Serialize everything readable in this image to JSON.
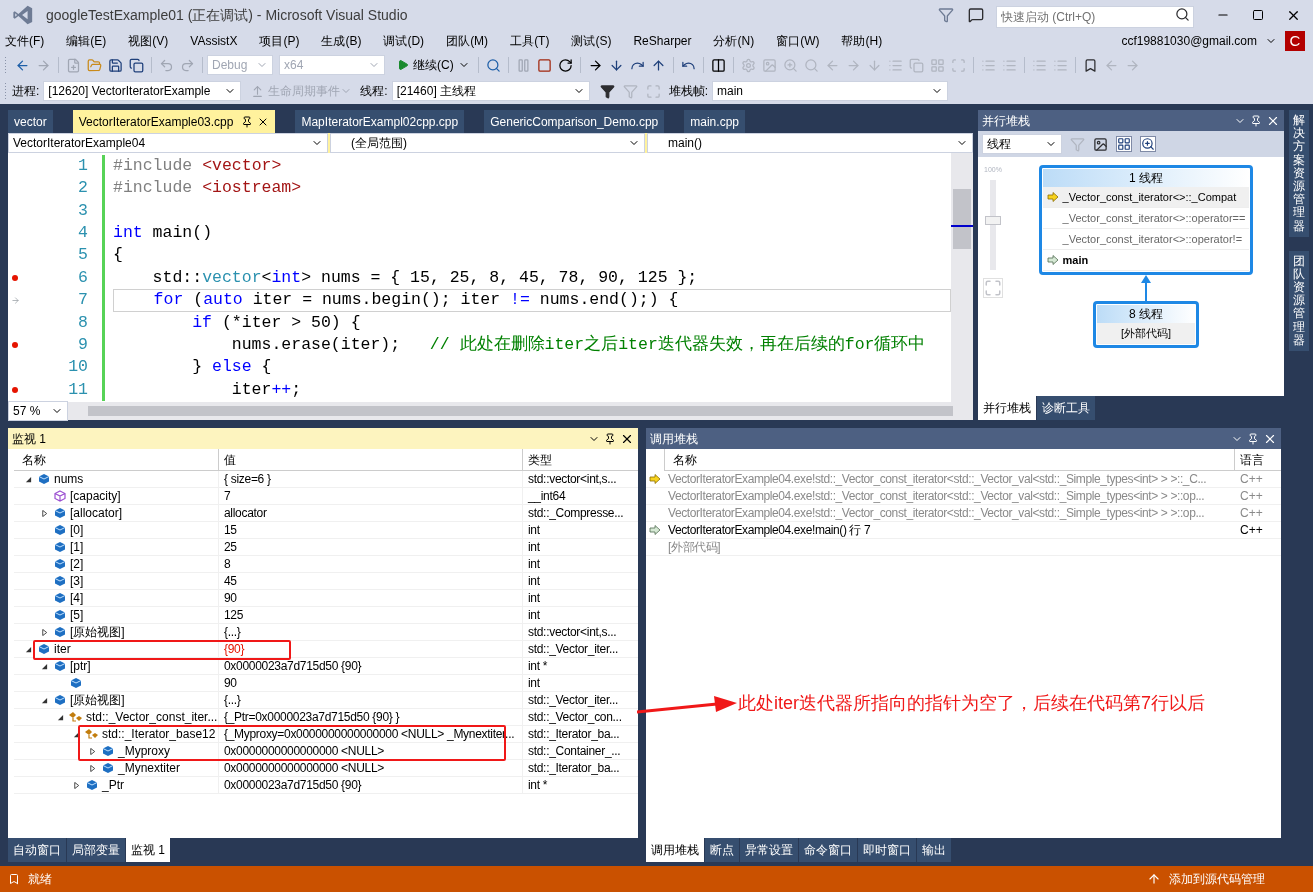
{
  "window": {
    "title": "googleTestExample01 (正在调试) - Microsoft Visual Studio",
    "quick_launch": {
      "placeholder": "快速启动 (Ctrl+Q)"
    },
    "account": "ccf19881030@gmail.com",
    "avatar_letter": "C"
  },
  "menu": [
    "文件(F)",
    "编辑(E)",
    "视图(V)",
    "VAssistX",
    "项目(P)",
    "生成(B)",
    "调试(D)",
    "团队(M)",
    "工具(T)",
    "测试(S)",
    "ReSharper",
    "分析(N)",
    "窗口(W)",
    "帮助(H)"
  ],
  "toolbar": {
    "configuration": "Debug",
    "platform": "x64",
    "continue": "继续(C)",
    "process_label": "进程:",
    "process": "[12620] VectorIteratorExample",
    "lifecycle": "生命周期事件",
    "thread_label": "线程:",
    "thread": "[21460] 主线程",
    "stack_frame_label": "堆栈帧:",
    "stack_frame": "main"
  },
  "document_tabs": [
    {
      "label": "vector",
      "selected": false
    },
    {
      "label": "VectorIteratorExample03.cpp",
      "selected": true
    },
    {
      "label": "MapIteratorExampl02cpp.cpp",
      "selected": false
    },
    {
      "label": "GenericComparison_Demo.cpp",
      "selected": false
    },
    {
      "label": "main.cpp",
      "selected": false
    }
  ],
  "navigation": {
    "project": "VectorIteratorExample04",
    "scope": "(全局范围)",
    "member": "main()"
  },
  "editor": {
    "zoom": "57 %",
    "lines": [
      {
        "number": "1",
        "breakpoint": false,
        "current": false,
        "tokens": [
          {
            "kind": "preprocessor",
            "text": "#include "
          },
          {
            "kind": "string",
            "text": "<vector>"
          }
        ]
      },
      {
        "number": "2",
        "breakpoint": false,
        "current": false,
        "tokens": [
          {
            "kind": "preprocessor",
            "text": "#include "
          },
          {
            "kind": "string",
            "text": "<iostream>"
          }
        ]
      },
      {
        "number": "3",
        "breakpoint": false,
        "current": false
      },
      {
        "number": "4",
        "breakpoint": false,
        "current": false,
        "tokens": [
          {
            "kind": "keyword",
            "text": "int"
          },
          {
            "kind": "plain",
            "text": " main()"
          }
        ]
      },
      {
        "number": "5",
        "breakpoint": false,
        "current": false,
        "tokens": [
          {
            "kind": "plain",
            "text": "{"
          }
        ]
      },
      {
        "number": "6",
        "breakpoint": true,
        "current": false,
        "tokens": [
          {
            "kind": "plain",
            "text": "    std::"
          },
          {
            "kind": "type",
            "text": "vector"
          },
          {
            "kind": "plain",
            "text": "<"
          },
          {
            "kind": "keyword",
            "text": "int"
          },
          {
            "kind": "plain",
            "text": "> nums = { 15, 25, 8, 45, 78, 90, 125 };"
          }
        ]
      },
      {
        "number": "7",
        "breakpoint": false,
        "current": true,
        "tokens": [
          {
            "kind": "keyword",
            "text": "    for"
          },
          {
            "kind": "plain",
            "text": " ("
          },
          {
            "kind": "keyword",
            "text": "auto"
          },
          {
            "kind": "plain",
            "text": " iter = nums.begin(); iter "
          },
          {
            "kind": "keyword",
            "text": "!="
          },
          {
            "kind": "plain",
            "text": " nums.end();) {"
          }
        ]
      },
      {
        "number": "8",
        "breakpoint": false,
        "current": false,
        "tokens": [
          {
            "kind": "keyword",
            "text": "        if"
          },
          {
            "kind": "plain",
            "text": " (*iter > 50) {"
          }
        ]
      },
      {
        "number": "9",
        "breakpoint": true,
        "current": false,
        "tokens": [
          {
            "kind": "plain",
            "text": "            nums.erase(iter);   "
          },
          {
            "kind": "comment",
            "text": "// 此处在删除iter之后iter迭代器失效，再在后续的for循环中"
          }
        ]
      },
      {
        "number": "10",
        "breakpoint": false,
        "current": false,
        "tokens": [
          {
            "kind": "plain",
            "text": "        } "
          },
          {
            "kind": "keyword",
            "text": "else"
          },
          {
            "kind": "plain",
            "text": " {"
          }
        ]
      },
      {
        "number": "11",
        "breakpoint": true,
        "current": false,
        "tokens": [
          {
            "kind": "plain",
            "text": "            iter"
          },
          {
            "kind": "keyword",
            "text": "++"
          },
          {
            "kind": "plain",
            "text": ";"
          }
        ]
      }
    ]
  },
  "parallel_stacks": {
    "title": "并行堆栈",
    "view": "线程",
    "zoom_label": "100%",
    "zoom": {
      "level": 0.55
    },
    "groups": [
      {
        "header": "1 线程",
        "frames": [
          {
            "text": "_Vector_const_iterator<>::_Compat",
            "kind": "current",
            "bold": false
          },
          {
            "text": "_Vector_const_iterator<>::operator==",
            "kind": "frame",
            "bold": false
          },
          {
            "text": "_Vector_const_iterator<>::operator!=",
            "kind": "frame",
            "bold": false
          },
          {
            "text": "main",
            "kind": "caller",
            "bold": true
          }
        ]
      },
      {
        "header": "8 线程",
        "frames": [
          {
            "text": "[外部代码]",
            "kind": "external",
            "bold": false
          }
        ]
      }
    ],
    "tabs": [
      {
        "label": "并行堆栈",
        "selected": true
      },
      {
        "label": "诊断工具",
        "selected": false
      }
    ]
  },
  "side_tabs": [
    "解决方案资源管理器",
    "团队资源管理器"
  ],
  "watch": {
    "title": "监视 1",
    "columns": [
      "名称",
      "值",
      "类型"
    ],
    "rows": [
      {
        "name": "nums",
        "value": "{ size=6 }",
        "type": "std::vector<int,s...",
        "kind": "field",
        "expanded": true,
        "changed": false,
        "children": [
          {
            "name": "[capacity]",
            "value": "7",
            "type": "__int64",
            "kind": "property",
            "changed": false
          },
          {
            "name": "[allocator]",
            "value": "allocator",
            "type": "std::_Compresse...",
            "kind": "field",
            "expanded": false,
            "changed": false
          },
          {
            "name": "[0]",
            "value": "15",
            "type": "int",
            "kind": "field",
            "changed": false
          },
          {
            "name": "[1]",
            "value": "25",
            "type": "int",
            "kind": "field",
            "changed": false
          },
          {
            "name": "[2]",
            "value": "8",
            "type": "int",
            "kind": "field",
            "changed": false
          },
          {
            "name": "[3]",
            "value": "45",
            "type": "int",
            "kind": "field",
            "changed": false
          },
          {
            "name": "[4]",
            "value": "90",
            "type": "int",
            "kind": "field",
            "changed": false
          },
          {
            "name": "[5]",
            "value": "125",
            "type": "int",
            "kind": "field",
            "changed": false
          },
          {
            "name": "[原始视图]",
            "value": "{...}",
            "type": "std::vector<int,s...",
            "kind": "field",
            "expanded": false,
            "changed": false
          }
        ]
      },
      {
        "name": "iter",
        "value": "{90}",
        "type": "std::_Vector_iter...",
        "kind": "field",
        "expanded": true,
        "changed": true,
        "children": [
          {
            "name": "[ptr]",
            "value": "0x0000023a7d715d50 {90}",
            "type": "int *",
            "kind": "field",
            "expanded": true,
            "changed": false,
            "children": [
              {
                "value": "90",
                "type": "int",
                "kind": "field",
                "changed": false
              }
            ]
          },
          {
            "name": "[原始视图]",
            "value": "{...}",
            "type": "std::_Vector_iter...",
            "kind": "field",
            "expanded": true,
            "changed": false,
            "children": [
              {
                "name": "std::_Vector_const_iter...",
                "value": "{_Ptr=0x0000023a7d715d50 {90} }",
                "type": "std::_Vector_con...",
                "kind": "base",
                "expanded": true,
                "changed": false,
                "children": [
                  {
                    "name": "std::_Iterator_base12",
                    "value": "{_Myproxy=0x0000000000000000 <NULL> _Mynextiter...",
                    "type": "std::_Iterator_ba...",
                    "kind": "base",
                    "expanded": true,
                    "changed": false,
                    "children": [
                      {
                        "name": "_Myproxy",
                        "value": "0x0000000000000000 <NULL>",
                        "type": "std::_Container_...",
                        "kind": "field",
                        "expanded": false,
                        "changed": false
                      },
                      {
                        "name": "_Mynextiter",
                        "value": "0x0000000000000000 <NULL>",
                        "type": "std::_Iterator_ba...",
                        "kind": "field",
                        "expanded": false,
                        "changed": false
                      }
                    ]
                  },
                  {
                    "name": "_Ptr",
                    "value": "0x0000023a7d715d50 {90}",
                    "type": "int *",
                    "kind": "field",
                    "expanded": false,
                    "changed": false
                  }
                ]
              }
            ]
          }
        ]
      }
    ],
    "tabs": [
      {
        "label": "自动窗口",
        "selected": false
      },
      {
        "label": "局部变量",
        "selected": false
      },
      {
        "label": "监视 1",
        "selected": true
      }
    ]
  },
  "call_stack": {
    "title": "调用堆栈",
    "columns": [
      "名称",
      "语言"
    ],
    "rows": [
      {
        "name": "VectorIteratorExample04.exe!std::_Vector_const_iterator<std::_Vector_val<std::_Simple_types<int> > >::_C...",
        "language": "C++",
        "kind": "current",
        "dimmed": true
      },
      {
        "name": "VectorIteratorExample04.exe!std::_Vector_const_iterator<std::_Vector_val<std::_Simple_types<int> > >::op...",
        "language": "C++",
        "kind": "frame",
        "dimmed": true
      },
      {
        "name": "VectorIteratorExample04.exe!std::_Vector_const_iterator<std::_Vector_val<std::_Simple_types<int> > >::op...",
        "language": "C++",
        "kind": "frame",
        "dimmed": true
      },
      {
        "name": "VectorIteratorExample04.exe!main() 行 7",
        "language": "C++",
        "kind": "caller",
        "dimmed": false
      },
      {
        "name": "[外部代码]",
        "kind": "frame",
        "dimmed": true
      }
    ],
    "tabs": [
      {
        "label": "调用堆栈",
        "selected": true
      },
      {
        "label": "断点",
        "selected": false
      },
      {
        "label": "异常设置",
        "selected": false
      },
      {
        "label": "命令窗口",
        "selected": false
      },
      {
        "label": "即时窗口",
        "selected": false
      },
      {
        "label": "输出",
        "selected": false
      }
    ]
  },
  "annotation": {
    "text": "此处iter迭代器所指向的指针为空了，后续在代码第7行以后"
  },
  "status_bar": {
    "text": "就绪",
    "source_control": "添加到源代码管理"
  }
}
